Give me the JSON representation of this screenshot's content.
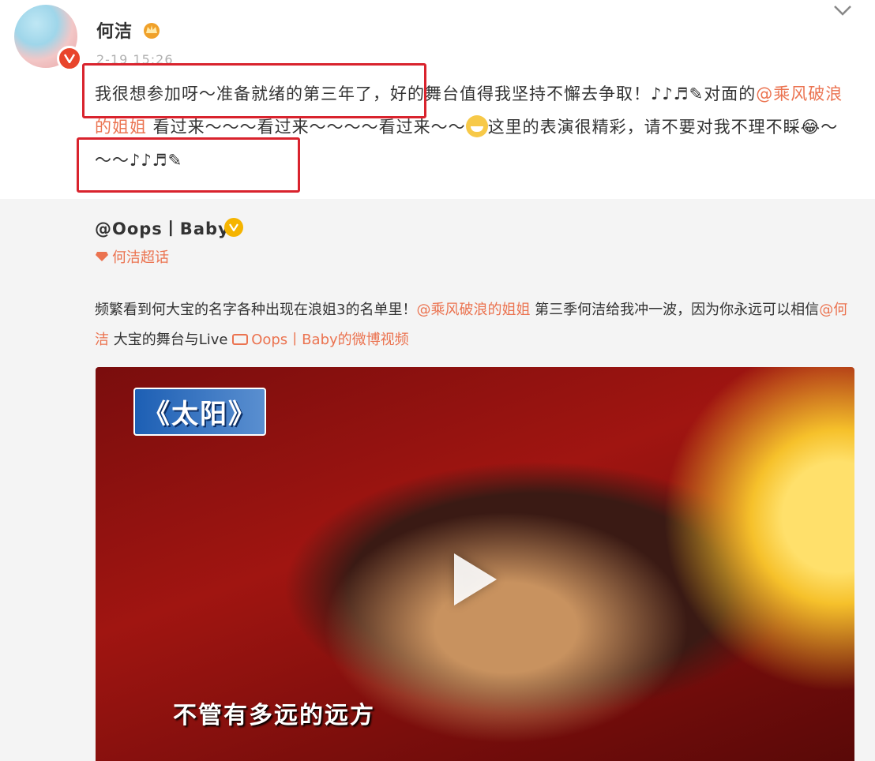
{
  "header": {
    "username": "何洁",
    "timestamp": "2-19 15:26",
    "vip_icon": "crown-icon",
    "menu_icon": "chevron-down-icon"
  },
  "post": {
    "text_parts": {
      "part1": "我很想参加呀～准备就绪的第三年了，好的舞台值得我坚持不懈去争取！♪♪♬✎对面的",
      "mention": "@乘风破浪的姐姐",
      "part2": " 看过来～～～看过来～～～～看过来～～",
      "part3": "这里的表演很精彩，请不要对我不理不睬😂～～～♪♪♬✎"
    }
  },
  "repost": {
    "author": "@Oops丨Baby",
    "supertopic": "何洁超话",
    "text_a": "频繁看到何大宝的名字各种出现在浪姐3的名单里！",
    "mention1": "@乘风破浪的姐姐",
    "text_b": " 第三季何洁给我冲一波，因为你永远可以相信",
    "mention2": "@何洁",
    "text_c": " 大宝的舞台与Live ",
    "video_link": "Oops丨Baby的微博视频"
  },
  "video": {
    "title_badge": "《太阳》",
    "subtitle": "不管有多远的远方",
    "play_icon": "play-icon"
  },
  "colors": {
    "accent": "#eb7350",
    "annotation": "#d9232d",
    "repost_bg": "#f4f4f4",
    "verified_red": "#e8452c",
    "verified_gold": "#f5b400"
  }
}
